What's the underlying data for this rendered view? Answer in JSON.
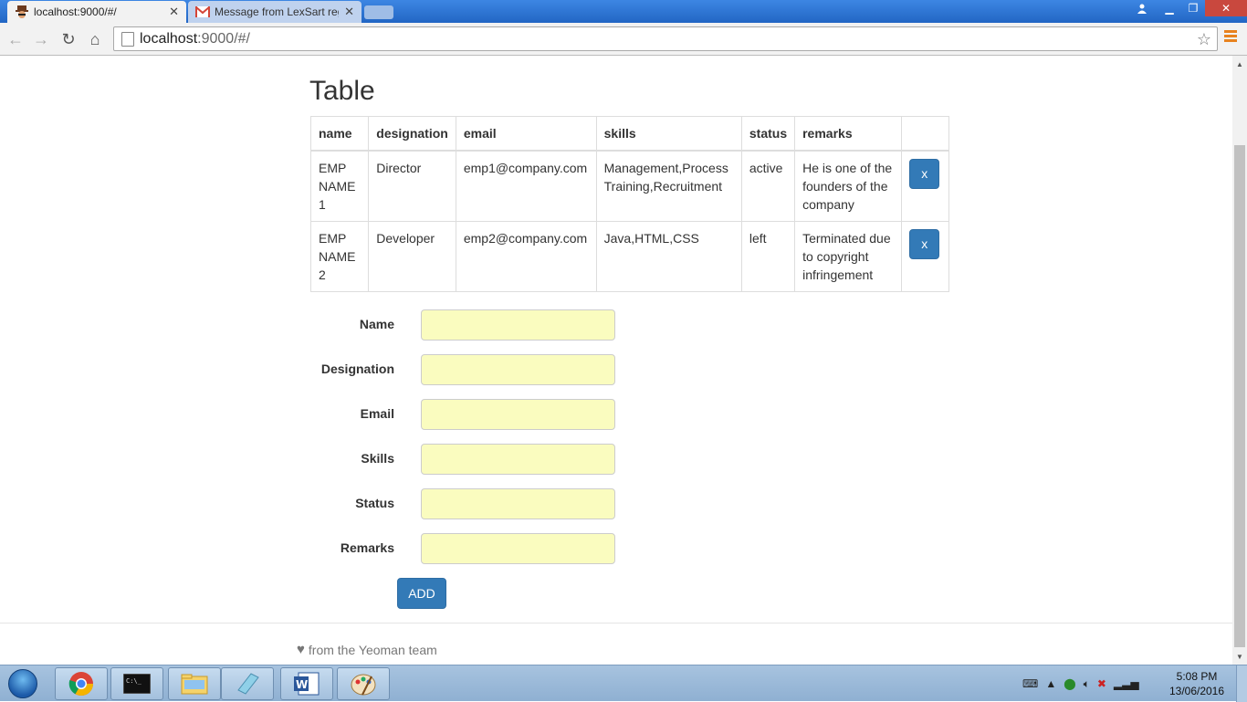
{
  "browser": {
    "tabs": [
      {
        "title": "localhost:9000/#/",
        "active": true,
        "icon": "yeoman-favicon"
      },
      {
        "title": "Message from LexSart reg",
        "active": false,
        "icon": "gmail-favicon"
      }
    ],
    "address": {
      "host": "localhost",
      "path": ":9000/#/"
    }
  },
  "page": {
    "title": "Table",
    "table": {
      "headers": [
        "name",
        "designation",
        "email",
        "skills",
        "status",
        "remarks",
        ""
      ],
      "rows": [
        {
          "name": "EMP NAME 1",
          "designation": "Director",
          "email": "emp1@company.com",
          "skills": "Management,Process Training,Recruitment",
          "status": "active",
          "remarks": "He is one of the founders of the company",
          "delete_label": "x"
        },
        {
          "name": "EMP NAME 2",
          "designation": "Developer",
          "email": "emp2@company.com",
          "skills": "Java,HTML,CSS",
          "status": "left",
          "remarks": "Terminated due to copyright infringement",
          "delete_label": "x"
        }
      ]
    },
    "form": {
      "fields": [
        {
          "label": "Name",
          "value": ""
        },
        {
          "label": "Designation",
          "value": ""
        },
        {
          "label": "Email",
          "value": ""
        },
        {
          "label": "Skills",
          "value": ""
        },
        {
          "label": "Status",
          "value": ""
        },
        {
          "label": "Remarks",
          "value": ""
        }
      ],
      "add_label": "ADD"
    },
    "footer": {
      "text": "from the Yeoman team",
      "icon": "heart-icon"
    }
  },
  "taskbar": {
    "items": [
      "chrome-icon",
      "cmd-icon",
      "file-explorer-icon",
      "notepad-icon",
      "word-icon",
      "paint-icon"
    ],
    "clock": {
      "time": "5:08 PM",
      "date": "13/06/2016"
    }
  },
  "colors": {
    "accent": "#337ab7",
    "input_background": "#fafcbf",
    "titlebar": "#2a74d4"
  }
}
